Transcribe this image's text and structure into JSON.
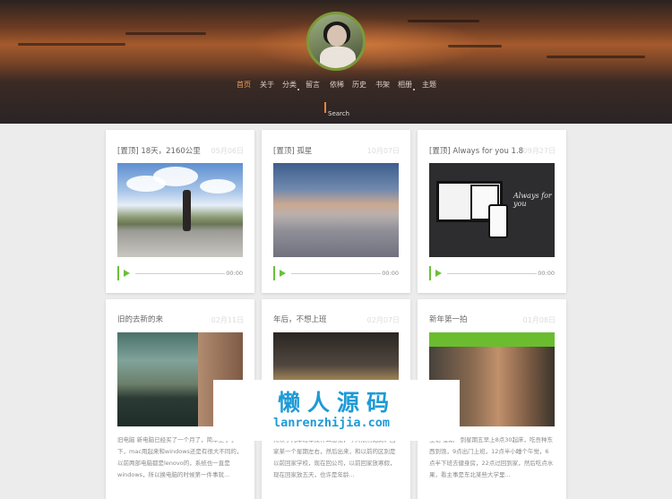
{
  "header": {
    "nav": [
      {
        "label": "首页",
        "active": true
      },
      {
        "label": "关于",
        "active": false
      },
      {
        "label": "分类",
        "active": false,
        "dropdown": true
      },
      {
        "label": "留言",
        "active": false
      },
      {
        "label": "依稀",
        "active": false
      },
      {
        "label": "历史",
        "active": false
      },
      {
        "label": "书架",
        "active": false
      },
      {
        "label": "相册",
        "active": false,
        "dropdown": true
      },
      {
        "label": "主题",
        "active": false
      }
    ],
    "search": {
      "placeholder": "Search"
    }
  },
  "posts": [
    {
      "title": "[置顶] 18天，2160公里",
      "date": "05月06日",
      "audio_time": "00:00"
    },
    {
      "title": "[置顶] 孤星",
      "date": "10月07日",
      "audio_time": "00:00"
    },
    {
      "title": "[置顶] Always for you 1.8",
      "date": "09月27日",
      "audio_time": "00:00",
      "image_text": "Always for you"
    },
    {
      "title": "旧的去新的来",
      "date": "02月11日",
      "excerpt": "旧电脑 新电脑已经买了一个月了，简单上手了下，mac用起来和windows还是有很大不同的，以前两部电脑都是lenovo的，系统也一直是windows，所以换电脑的时候第一件事就..."
    },
    {
      "title": "年后，不想上班",
      "date": "02月07日",
      "excerpt": "持续了几年过年没什么感觉，今天依然如此，回家某一个星期左右，然后出来，和以前的区别是以前回家学校，现在回公司，以前回家放寒假，现在回家放五天，也许是年龄..."
    },
    {
      "title": "新年第一拍",
      "date": "01月08日",
      "excerpt": "主语 星期一到星期五早上8点30起床，吃吾种东西到饱，9点出门上班，12点半小睡个午觉，6点半下班去健身房，22点过回到家，然后吃点水果，看主事是东北某些大学里..."
    }
  ],
  "watermark": {
    "cn": "懒人源码",
    "en": "lanrenzhijia.com"
  },
  "colors": {
    "accent": "#f2a15a",
    "audio": "#6cbf3b",
    "watermark": "#1e9ad6"
  }
}
